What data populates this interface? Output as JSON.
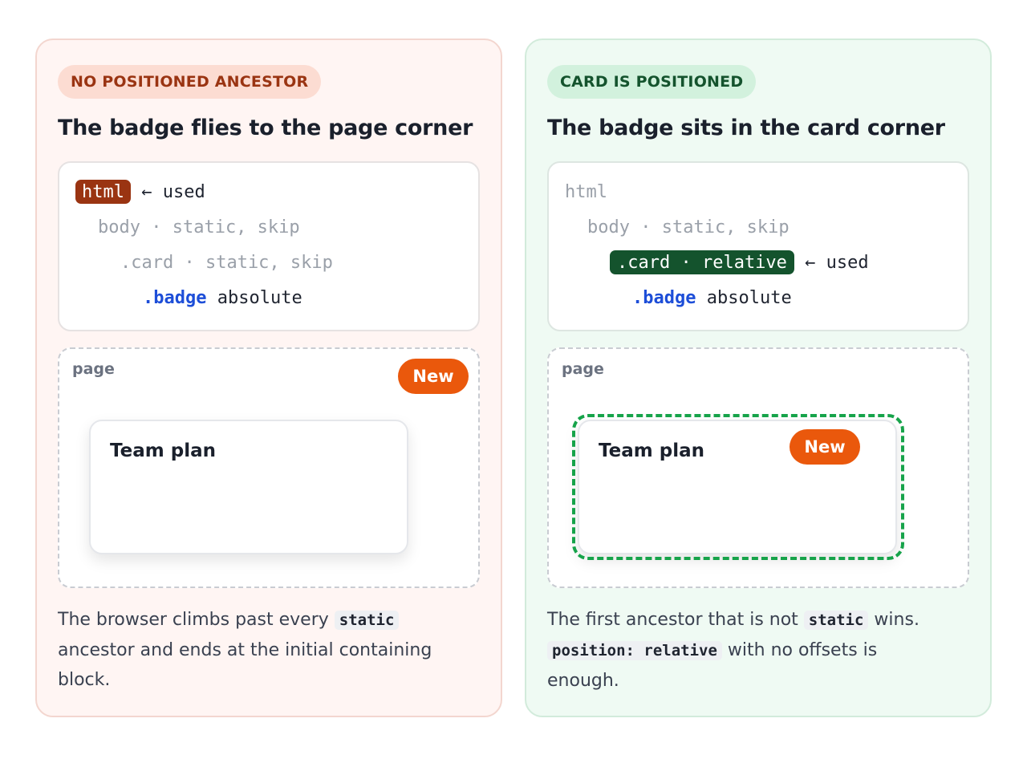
{
  "left": {
    "pill": "NO POSITIONED ANCESTOR",
    "heading": "The badge flies to the page corner",
    "tree": {
      "html": "html",
      "html_note": " ← used",
      "body": "body · static, skip",
      "card": ".card · static, skip",
      "badge_sel": ".badge",
      "badge_rest": " absolute"
    },
    "stage_label": "page",
    "card_title": "Team plan",
    "badge": "New",
    "caption": {
      "part1": "The browser climbs past every ",
      "code1": "static",
      "part2": " ancestor and ends at the initial containing block."
    }
  },
  "right": {
    "pill": "CARD IS POSITIONED",
    "heading": "The badge sits in the card corner",
    "tree": {
      "html": "html",
      "body": "body · static, skip",
      "card": ".card · relative",
      "card_note": " ← used",
      "badge_sel": ".badge",
      "badge_rest": " absolute"
    },
    "stage_label": "page",
    "card_title": "Team plan",
    "badge": "New",
    "caption": {
      "part1": "The first ancestor that is not ",
      "code1": "static",
      "part2": " wins. ",
      "code2": "position: relative",
      "part3": " with no offsets is enough."
    }
  },
  "colors": {
    "badge": "#ea580c",
    "left_accent": "#9a3412",
    "right_accent": "#14532d",
    "outline": "#16a34a",
    "selector_blue": "#1d4ed8"
  }
}
